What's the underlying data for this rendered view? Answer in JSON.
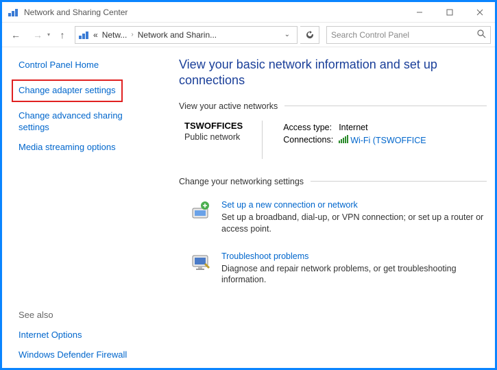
{
  "window": {
    "title": "Network and Sharing Center"
  },
  "breadcrumb": {
    "level1": "Netw...",
    "level2": "Network and Sharin...",
    "prefix": "«"
  },
  "search": {
    "placeholder": "Search Control Panel"
  },
  "sidebar": {
    "home": "Control Panel Home",
    "adapter": "Change adapter settings",
    "advanced": "Change advanced sharing settings",
    "streaming": "Media streaming options",
    "see_also_label": "See also",
    "internet_options": "Internet Options",
    "firewall": "Windows Defender Firewall"
  },
  "main": {
    "heading": "View your basic network information and set up connections",
    "active_label": "View your active networks",
    "network": {
      "name": "TSWOFFICES",
      "type": "Public network",
      "access_label": "Access type:",
      "access_value": "Internet",
      "conn_label": "Connections:",
      "conn_link": "Wi-Fi (TSWOFFICE"
    },
    "change_label": "Change your networking settings",
    "setup": {
      "title": "Set up a new connection or network",
      "desc": "Set up a broadband, dial-up, or VPN connection; or set up a router or access point."
    },
    "troubleshoot": {
      "title": "Troubleshoot problems",
      "desc": "Diagnose and repair network problems, or get troubleshooting information."
    }
  }
}
